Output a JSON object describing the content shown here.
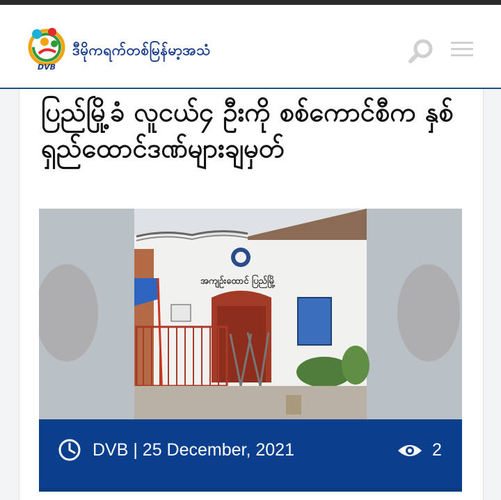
{
  "header": {
    "brand_name": "ဒီမိုကရက်တစ်မြန်မာ့အသံ",
    "logo_text": "DVB",
    "icons": {
      "search": "search-icon",
      "menu": "hamburger-menu-icon",
      "logo": "dvb-logo-icon"
    }
  },
  "article": {
    "title": "ပြည်မြို့ခံ လူငယ်၄ ဦးကို စစ်ကောင်စီက နှစ်ရှည်ထောင်ဒဏ်များချမှတ်",
    "image": {
      "sign_text": "အကျဉ်းထောင် ပြည်မြို့"
    },
    "meta": {
      "author_date": "DVB | 25 December, 2021",
      "views": "2",
      "icons": {
        "date": "clock-icon",
        "views": "eye-icon"
      }
    }
  },
  "colors": {
    "brand_blue": "#1b3e8c",
    "meta_bar": "#0a3f8d",
    "header_border": "#1d4f8f",
    "icon_gray": "#d0d0d0"
  }
}
